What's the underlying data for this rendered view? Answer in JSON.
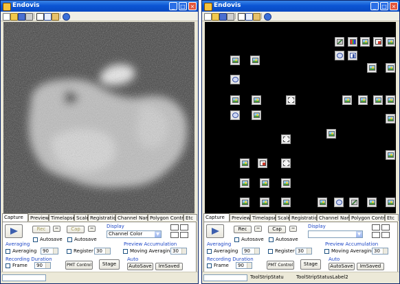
{
  "app": {
    "title": "Endovis"
  },
  "tabs": [
    "Capture",
    "Preview",
    "Timelapse",
    "Scale",
    "Registration",
    "Channel Name",
    "Polygon Control",
    "Etc"
  ],
  "capture": {
    "rec_label": "Rec",
    "cap_label": "Cap",
    "autosave_label": "Autosave",
    "small_btn_label": "~",
    "display_group": "Display",
    "display_value_left": "Channel Color",
    "display_value_right": "",
    "averaging_group": "Averaging",
    "averaging_label": "Averaging",
    "averaging_value": "90",
    "register_label": "Register",
    "register_value": "30",
    "preview_acc_group": "Preview Accumulation",
    "moving_avg_label": "Moving Averaging",
    "moving_avg_value": "30",
    "recording_group": "Recording Duration",
    "frame_label": "Frame",
    "frame_value": "90",
    "pmt_label": "PMT Control",
    "stage_label": "Stage",
    "auto_group": "Auto",
    "autosave_btn": "AutoSave",
    "imsaved_btn": "ImSaved"
  },
  "status": {
    "label1": "ToolStripStatu",
    "label2": "ToolStripStatusLabel2"
  },
  "icons": {
    "window": "app-icon",
    "minimize": "minimize-icon",
    "maximize": "maximize-icon",
    "close": "close-icon",
    "play": "play-icon"
  },
  "colors": {
    "titlebar": "#0b55d4",
    "group_text": "#1c45c6",
    "close_button": "#e2553b"
  },
  "left_view": {
    "kind": "grayscale-noise-image"
  },
  "right_view": {
    "kind": "icon-canvas",
    "icons": [
      {
        "type": "tool"
      },
      {
        "type": "rgb"
      },
      {
        "type": "pic"
      },
      {
        "type": "abc"
      },
      {
        "type": "pic"
      },
      {
        "type": "gear"
      },
      {
        "type": "flow"
      },
      {
        "type": "pic"
      },
      {
        "type": "pic"
      },
      {
        "type": "pic"
      },
      {
        "type": "pic"
      },
      {
        "type": "gear"
      },
      {
        "type": "pic"
      },
      {
        "type": "pic"
      },
      {
        "type": "hand"
      },
      {
        "type": "pic"
      },
      {
        "type": "pic"
      },
      {
        "type": "pic"
      },
      {
        "type": "pic"
      },
      {
        "type": "gear"
      },
      {
        "type": "pic"
      },
      {
        "type": "pic"
      },
      {
        "type": "pic"
      },
      {
        "type": "hand"
      },
      {
        "type": "pic"
      },
      {
        "type": "pic"
      },
      {
        "type": "abc"
      },
      {
        "type": "hand"
      },
      {
        "type": "pic"
      },
      {
        "type": "pic"
      },
      {
        "type": "pic"
      },
      {
        "type": "pic"
      },
      {
        "type": "pic"
      },
      {
        "type": "pic"
      },
      {
        "type": "pic"
      },
      {
        "type": "gear"
      },
      {
        "type": "tool"
      },
      {
        "type": "pic"
      },
      {
        "type": "pic"
      }
    ]
  }
}
